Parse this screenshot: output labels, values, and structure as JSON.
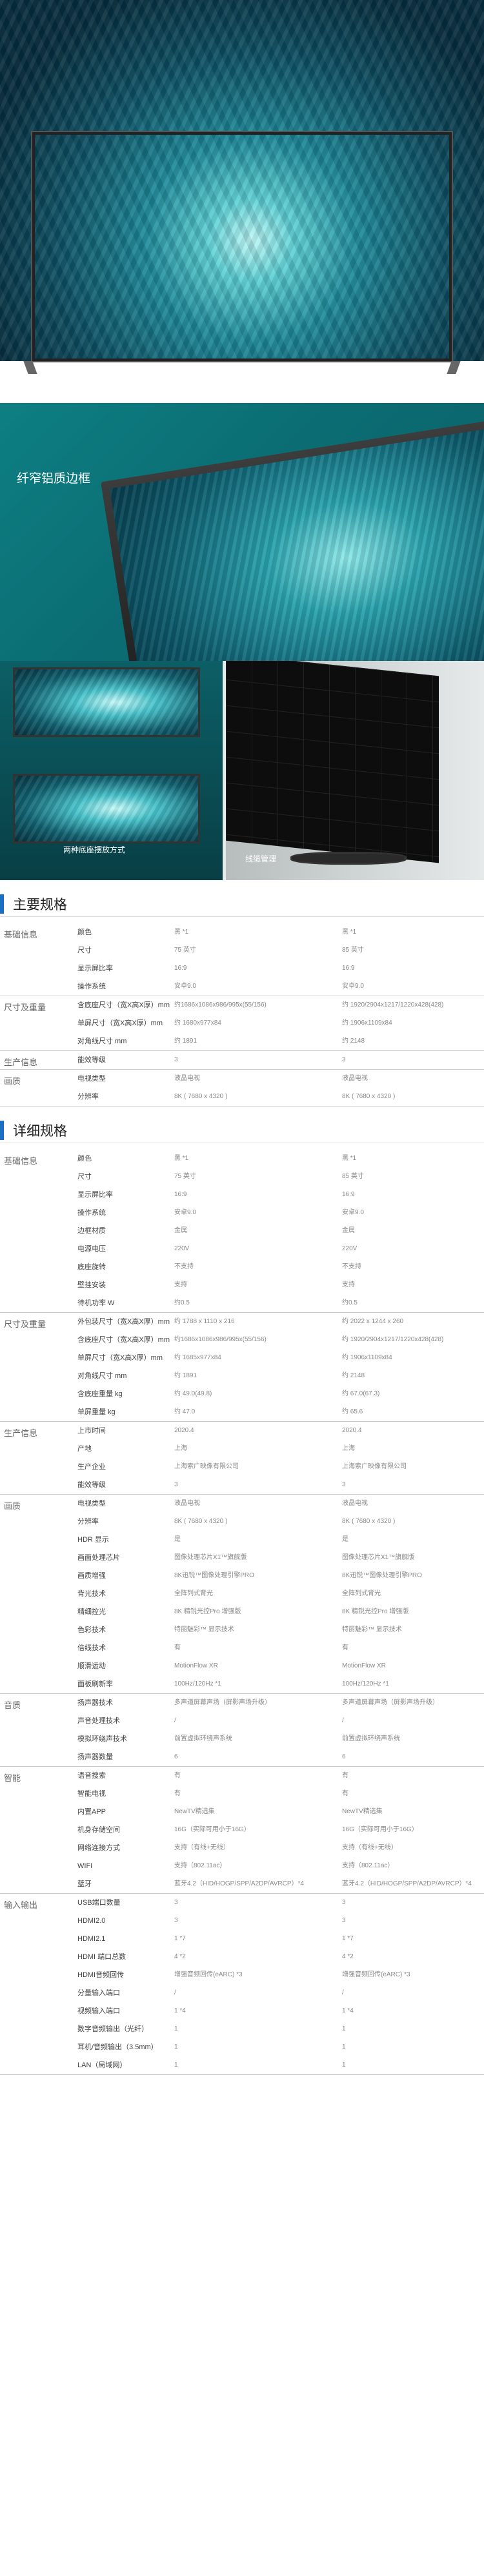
{
  "images": {
    "frame_label": "纤窄铝质边框",
    "duo_caption_left": "两种底座摆放方式",
    "duo_caption_right": "线缆管理"
  },
  "colors": {
    "accent": "#1a6fc3",
    "teal": "#0d7f83"
  },
  "main_spec": {
    "title": "主要规格",
    "groups": [
      {
        "name": "基础信息",
        "rows": [
          {
            "k": "颜色",
            "v1": "黑 *1",
            "v2": "黑 *1"
          },
          {
            "k": "尺寸",
            "v1": "75 英寸",
            "v2": "85 英寸"
          },
          {
            "k": "显示屏比率",
            "v1": "16:9",
            "v2": "16:9"
          },
          {
            "k": "操作系统",
            "v1": "安卓9.0",
            "v2": "安卓9.0"
          }
        ]
      },
      {
        "name": "尺寸及重量",
        "rows": [
          {
            "k": "含底座尺寸（宽X高X厚）mm",
            "v1": "约1686x1086x986/995x(55/156)",
            "v2": "约 1920/2904x1217/1220x428(428)"
          },
          {
            "k": "单屏尺寸（宽X高X厚）mm",
            "v1": "约 1680x977x84",
            "v2": "约 1906x1109x84"
          },
          {
            "k": "对角线尺寸 mm",
            "v1": "约 1891",
            "v2": "约 2148"
          }
        ]
      },
      {
        "name": "生产信息",
        "rows": [
          {
            "k": "能效等级",
            "v1": "3",
            "v2": "3"
          }
        ]
      },
      {
        "name": "画质",
        "rows": [
          {
            "k": "电视类型",
            "v1": "液晶电视",
            "v2": "液晶电视"
          },
          {
            "k": "分辨率",
            "v1": "8K ( 7680 x 4320 )",
            "v2": "8K ( 7680 x 4320 )"
          }
        ]
      }
    ]
  },
  "detail_spec": {
    "title": "详细规格",
    "groups": [
      {
        "name": "基础信息",
        "rows": [
          {
            "k": "颜色",
            "v1": "黑 *1",
            "v2": "黑 *1"
          },
          {
            "k": "尺寸",
            "v1": "75 英寸",
            "v2": "85 英寸"
          },
          {
            "k": "显示屏比率",
            "v1": "16:9",
            "v2": "16:9"
          },
          {
            "k": "操作系统",
            "v1": "安卓9.0",
            "v2": "安卓9.0"
          },
          {
            "k": "边框材质",
            "v1": "金属",
            "v2": "金属"
          },
          {
            "k": "电源电压",
            "v1": "220V",
            "v2": "220V"
          },
          {
            "k": "底座旋转",
            "v1": "不支持",
            "v2": "不支持"
          },
          {
            "k": "壁挂安装",
            "v1": "支持",
            "v2": "支持"
          },
          {
            "k": "待机功率 W",
            "v1": "约0.5",
            "v2": "约0.5"
          }
        ]
      },
      {
        "name": "尺寸及重量",
        "rows": [
          {
            "k": "外包装尺寸（宽X高X厚）mm",
            "v1": "约 1788 x 1110 x 216",
            "v2": "约 2022 x 1244 x 260"
          },
          {
            "k": "含底座尺寸（宽X高X厚）mm",
            "v1": "约1686x1086x986/995x(55/156)",
            "v2": "约 1920/2904x1217/1220x428(428)"
          },
          {
            "k": "单屏尺寸（宽X高X厚）mm",
            "v1": "约 1685x977x84",
            "v2": "约 1906x1109x84"
          },
          {
            "k": "对角线尺寸 mm",
            "v1": "约 1891",
            "v2": "约 2148"
          },
          {
            "k": "含底座重量 kg",
            "v1": "约 49.0(49.8)",
            "v2": "约 67.0(67.3)"
          },
          {
            "k": "单屏重量 kg",
            "v1": "约 47.0",
            "v2": "约 65.6"
          }
        ]
      },
      {
        "name": "生产信息",
        "rows": [
          {
            "k": "上市时间",
            "v1": "2020.4",
            "v2": "2020.4"
          },
          {
            "k": "产地",
            "v1": "上海",
            "v2": "上海"
          },
          {
            "k": "生产企业",
            "v1": "上海索广映像有限公司",
            "v2": "上海索广映像有限公司"
          },
          {
            "k": "能效等级",
            "v1": "3",
            "v2": "3"
          }
        ]
      },
      {
        "name": "画质",
        "rows": [
          {
            "k": "电视类型",
            "v1": "液晶电视",
            "v2": "液晶电视"
          },
          {
            "k": "分辨率",
            "v1": "8K ( 7680 x 4320 )",
            "v2": "8K ( 7680 x 4320 )"
          },
          {
            "k": "HDR 显示",
            "v1": "是",
            "v2": "是"
          },
          {
            "k": "画面处理芯片",
            "v1": "图像处理芯片X1™旗舰版",
            "v2": "图像处理芯片X1™旗舰版"
          },
          {
            "k": "画质增强",
            "v1": "8K迅锐™图像处理引擎PRO",
            "v2": "8K迅锐™图像处理引擎PRO"
          },
          {
            "k": "背光技术",
            "v1": "全阵列式背光",
            "v2": "全阵列式背光"
          },
          {
            "k": "精细控光",
            "v1": "8K 精锐光控Pro 增强版",
            "v2": "8K 精锐光控Pro 增强版"
          },
          {
            "k": "色彩技术",
            "v1": "特丽魅彩™ 显示技术",
            "v2": "特丽魅彩™ 显示技术"
          },
          {
            "k": "倍线技术",
            "v1": "有",
            "v2": "有"
          },
          {
            "k": "顺滑运动",
            "v1": "MotionFlow XR",
            "v2": "MotionFlow XR"
          },
          {
            "k": "面板刷新率",
            "v1": "100Hz/120Hz *1",
            "v2": "100Hz/120Hz *1"
          }
        ]
      },
      {
        "name": "音质",
        "rows": [
          {
            "k": "扬声器技术",
            "v1": "多声道屏幕声场（屏影声场升级）",
            "v2": "多声道屏幕声场（屏影声场升级）"
          },
          {
            "k": "声音处理技术",
            "v1": "/",
            "v2": "/"
          },
          {
            "k": "模拟环绕声技术",
            "v1": "前置虚拟环绕声系统",
            "v2": "前置虚拟环绕声系统"
          },
          {
            "k": "扬声器数量",
            "v1": "6",
            "v2": "6"
          }
        ]
      },
      {
        "name": "智能",
        "rows": [
          {
            "k": "语音搜索",
            "v1": "有",
            "v2": "有"
          },
          {
            "k": "智能电视",
            "v1": "有",
            "v2": "有"
          },
          {
            "k": "内置APP",
            "v1": "NewTV精选集",
            "v2": "NewTV精选集"
          },
          {
            "k": "机身存储空间",
            "v1": "16G（实际可用小于16G）",
            "v2": "16G（实际可用小于16G）"
          },
          {
            "k": "网络连接方式",
            "v1": "支持（有线+无线）",
            "v2": "支持（有线+无线）"
          },
          {
            "k": "WIFI",
            "v1": "支持（802.11ac）",
            "v2": "支持（802.11ac）"
          },
          {
            "k": "蓝牙",
            "v1": "蓝牙4.2（HID/HOGP/SPP/A2DP/AVRCP）*4",
            "v2": "蓝牙4.2（HID/HOGP/SPP/A2DP/AVRCP）*4"
          }
        ]
      },
      {
        "name": "输入输出",
        "rows": [
          {
            "k": "USB端口数量",
            "v1": "3",
            "v2": "3"
          },
          {
            "k": "HDMI2.0",
            "v1": "3",
            "v2": "3"
          },
          {
            "k": "HDMI2.1",
            "v1": "1 *7",
            "v2": "1 *7"
          },
          {
            "k": "HDMI 端口总数",
            "v1": "4 *2",
            "v2": "4 *2"
          },
          {
            "k": "HDMI音频回传",
            "v1": "增强音频回传(eARC) *3",
            "v2": "增强音频回传(eARC) *3"
          },
          {
            "k": "分量输入端口",
            "v1": "/",
            "v2": "/"
          },
          {
            "k": "视频输入端口",
            "v1": "1 *4",
            "v2": "1 *4"
          },
          {
            "k": "数字音频输出（光纤）",
            "v1": "1",
            "v2": "1"
          },
          {
            "k": "耳机/音频输出（3.5mm）",
            "v1": "1",
            "v2": "1"
          },
          {
            "k": "LAN（局域网）",
            "v1": "1",
            "v2": "1"
          }
        ]
      }
    ]
  }
}
